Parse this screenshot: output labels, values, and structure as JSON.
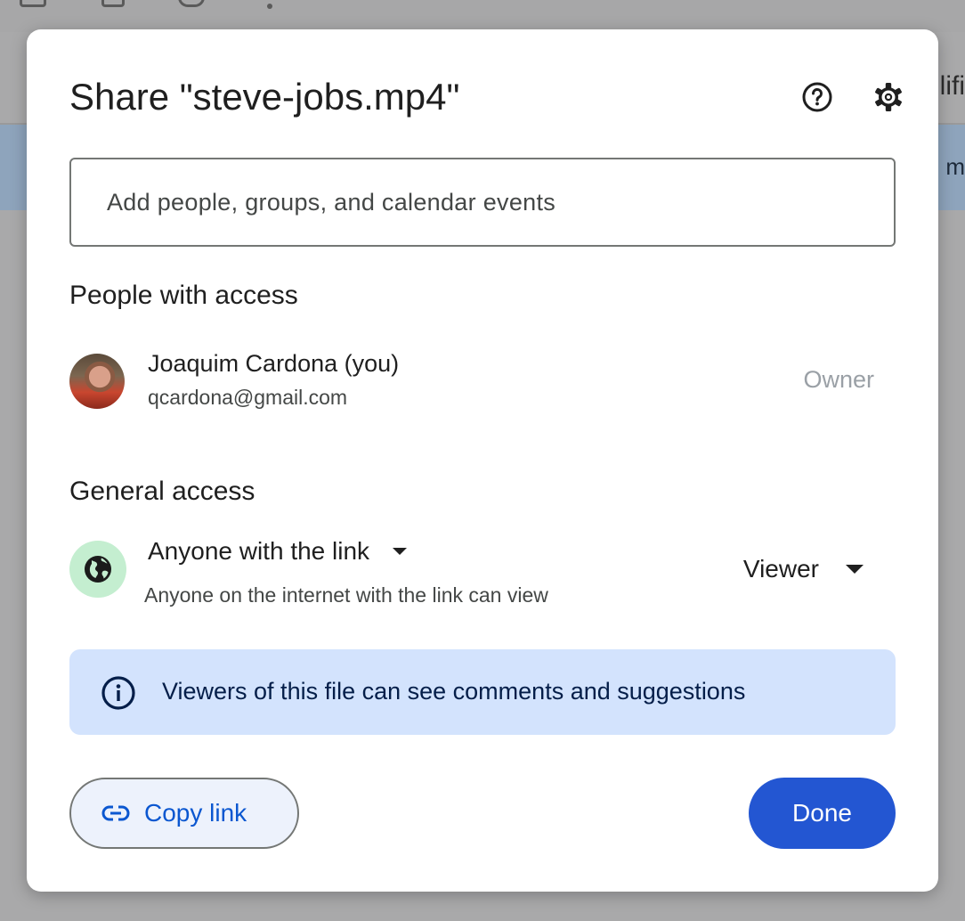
{
  "background": {
    "header_text": "lifi",
    "banner_text": "m"
  },
  "dialog": {
    "title": "Share \"steve-jobs.mp4\"",
    "help_icon": "help-circle-icon",
    "settings_icon": "gear-icon"
  },
  "add_people": {
    "placeholder": "Add people, groups, and calendar events",
    "value": ""
  },
  "people_with_access": {
    "heading": "People with access",
    "people": [
      {
        "name": "Joaquim Cardona (you)",
        "email": "qcardona@gmail.com",
        "role": "Owner"
      }
    ]
  },
  "general_access": {
    "heading": "General access",
    "icon": "globe-icon",
    "access_level": "Anyone with the link",
    "description": "Anyone on the internet with the link can view",
    "role": "Viewer"
  },
  "info": {
    "icon": "info-icon",
    "text": "Viewers of this file can see comments and suggestions"
  },
  "actions": {
    "copy_link_label": "Copy link",
    "done_label": "Done"
  },
  "colors": {
    "accent": "#0b57d0",
    "done_button": "#2356d2",
    "info_background": "#d3e3fd",
    "globe_background": "#c4eed0"
  }
}
